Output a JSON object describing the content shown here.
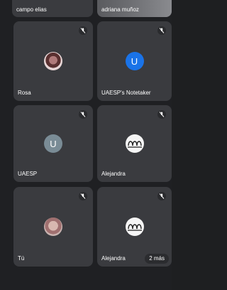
{
  "participants_top": [
    {
      "name": "campo elias"
    },
    {
      "name": "adriana muñoz"
    }
  ],
  "participants": [
    {
      "name": "Rosa",
      "avatar": "photo",
      "muted": true
    },
    {
      "name": "UAESP's Notetaker",
      "avatar_letter": "U",
      "avatar_color": "#1a73e8",
      "muted": true
    },
    {
      "name": "UAESP",
      "avatar_letter": "U",
      "avatar_color": "#7a8c96",
      "muted": true
    },
    {
      "name": "Alejandra",
      "avatar": "photo",
      "muted": true
    },
    {
      "name": "Tú",
      "avatar": "photo",
      "muted": true
    },
    {
      "name": "Alejandra",
      "avatar": "photo",
      "muted": true
    }
  ],
  "more_badge": "2 más",
  "icons": {
    "mute": "mic-off-icon"
  },
  "colors": {
    "background": "#1f2023",
    "tile": "#3a3b3f"
  }
}
